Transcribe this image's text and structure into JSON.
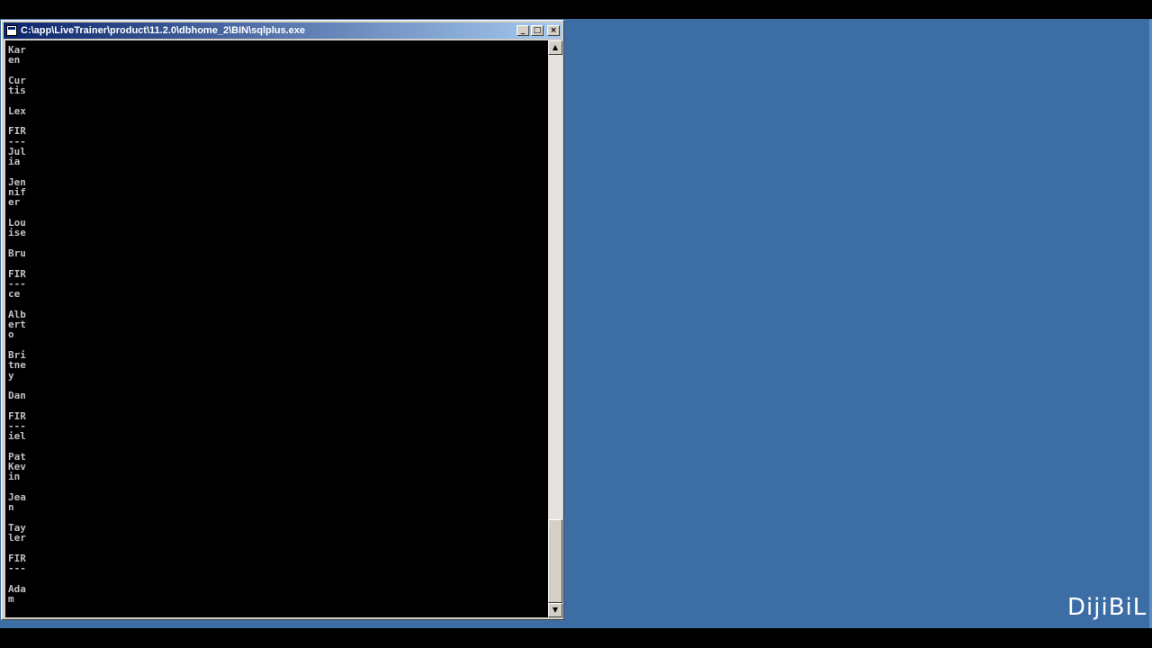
{
  "window": {
    "title": "C:\\app\\LiveTrainer\\product\\11.2.0\\dbhome_2\\BIN\\sqlplus.exe",
    "minimize_glyph": "_",
    "maximize_glyph": "□",
    "close_glyph": "×"
  },
  "console": {
    "lines": [
      "Kar",
      "en",
      "",
      "Cur",
      "tis",
      "",
      "Lex",
      "",
      "FIR",
      "---",
      "Jul",
      "ia",
      "",
      "Jen",
      "nif",
      "er",
      "",
      "Lou",
      "ise",
      "",
      "Bru",
      "",
      "FIR",
      "---",
      "ce",
      "",
      "Alb",
      "ert",
      "o",
      "",
      "Bri",
      "tne",
      "y",
      "",
      "Dan",
      "",
      "FIR",
      "---",
      "iel",
      "",
      "Pat",
      "Kev",
      "in",
      "",
      "Jea",
      "n",
      "",
      "Tay",
      "ler",
      "",
      "FIR",
      "---",
      "",
      "Ada",
      "m"
    ]
  },
  "scrollbar": {
    "up_glyph": "▲",
    "down_glyph": "▼"
  },
  "branding": {
    "logo_text": "DijiBiL"
  },
  "colors": {
    "desktop": "#3c6ea5",
    "titlebar_start": "#0a246a",
    "titlebar_end": "#a6caf0",
    "console_bg": "#000000",
    "console_text": "#c0c0c0"
  }
}
